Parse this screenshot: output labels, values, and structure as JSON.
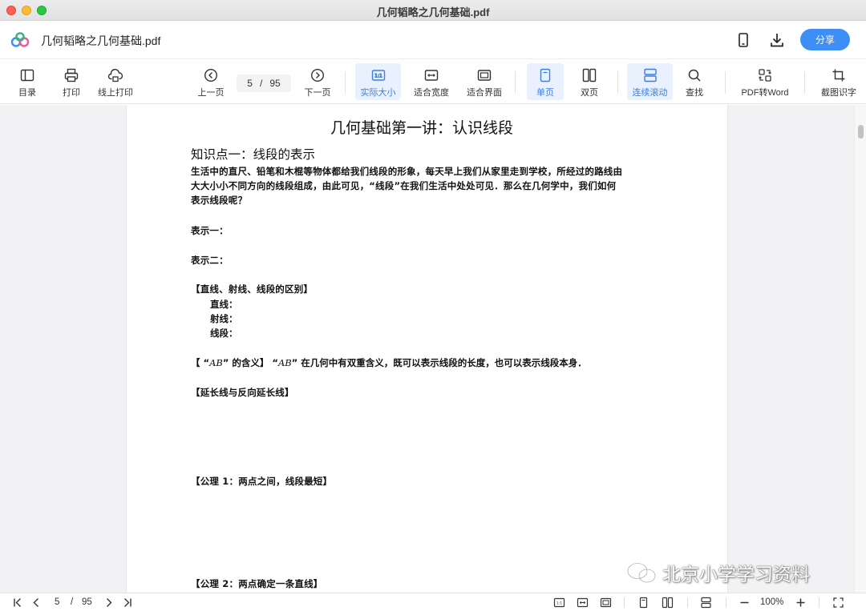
{
  "window": {
    "title": "几何韬略之几何基础.pdf"
  },
  "header": {
    "doc_title": "几何韬略之几何基础.pdf",
    "share_label": "分享"
  },
  "toolbar": {
    "toc": "目录",
    "print": "打印",
    "online_print": "线上打印",
    "prev": "上一页",
    "current_page": "5",
    "page_sep": "/",
    "total_pages": "95",
    "next": "下一页",
    "actual_size": "实际大小",
    "fit_width": "适合宽度",
    "fit_page": "适合界面",
    "single_page": "单页",
    "double_page": "双页",
    "continuous": "连续滚动",
    "find": "查找",
    "pdf_to_word": "PDF转Word",
    "ocr": "截图识字"
  },
  "document": {
    "title": "几何基础第一讲：认识线段",
    "heading1": "知识点一：线段的表示",
    "para1": [
      "生活中的直尺、铅笔和木棍等物体都给我们线段的形象，每天早上我们从家里走到学校，所经过的路线由",
      "大大小小不同方向的线段组成，由此可见，“线段”在我们生活中处处可见．那么在几何学中，我们如何",
      "表示线段呢？"
    ],
    "rep1": "表示一：",
    "rep2": "表示二：",
    "diff_heading": "【直线、射线、线段的区别】",
    "line": "直线：",
    "ray": "射线：",
    "segment": "线段：",
    "ab_open": "【 “",
    "ab_sym1": "AB",
    "ab_mid": "” 的含义】 “",
    "ab_sym2": "AB",
    "ab_rest": "” 在几何中有双重含义，既可以表示线段的长度，也可以表示线段本身．",
    "extension": "【延长线与反向延长线】",
    "axiom1": "【公理 1：两点之间，线段最短】",
    "axiom2": "【公理 2：两点确定一条直线】"
  },
  "watermark": {
    "text": "北京小学学习资料"
  },
  "statusbar": {
    "current_page": "5",
    "page_sep": "/",
    "total_pages": "95",
    "zoom": "100%"
  },
  "colors": {
    "accent": "#3d8ef5",
    "active_bg": "#e8f1fd",
    "active_text": "#3d7fe0"
  }
}
